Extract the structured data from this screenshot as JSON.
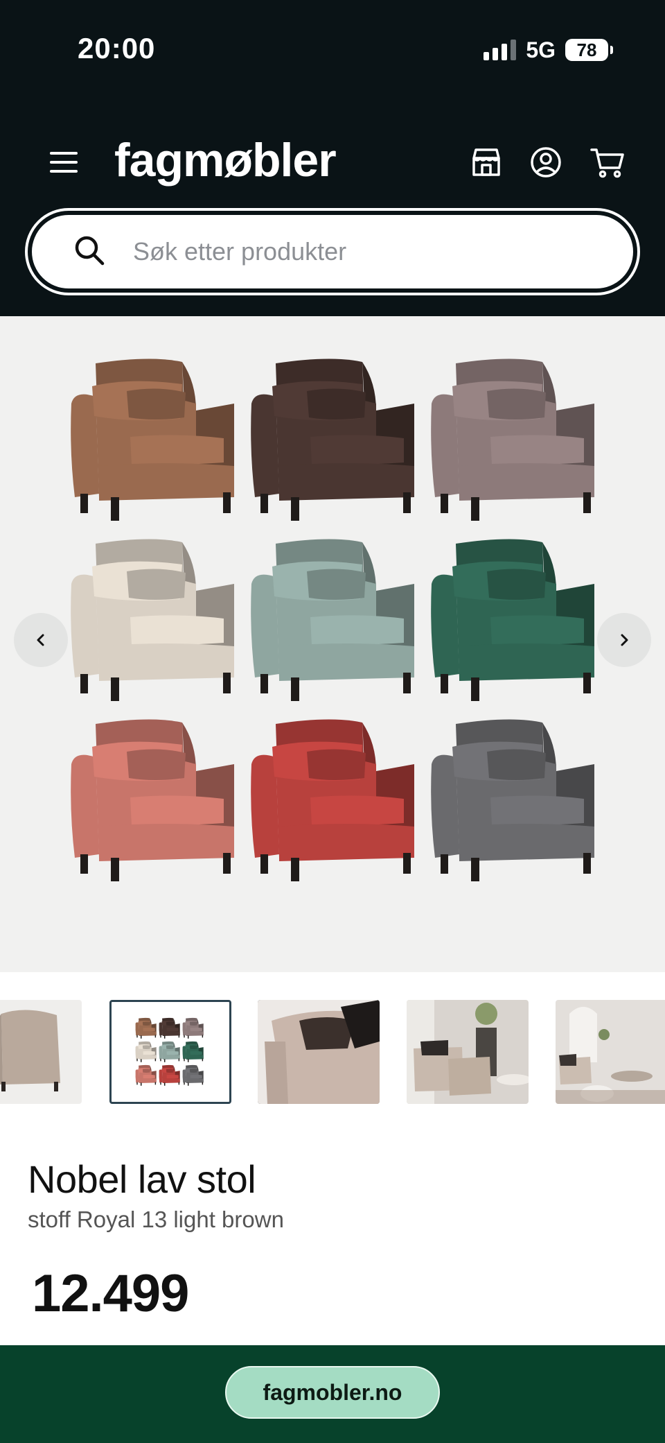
{
  "status_bar": {
    "time": "20:00",
    "network": "5G",
    "battery": "78"
  },
  "header": {
    "logo": "fagmøbler",
    "icons": [
      "menu-icon",
      "store-icon",
      "account-icon",
      "cart-icon"
    ]
  },
  "search": {
    "placeholder": "Søk etter produkter",
    "value": ""
  },
  "gallery": {
    "image_alt": "Nobel lav stol color variants",
    "chair_colors": [
      "#9a6a4f",
      "#4a3631",
      "#8d7a7a",
      "#d9d0c4",
      "#8fa6a0",
      "#2f6553",
      "#c8756a",
      "#b8413d",
      "#6a6a6d"
    ]
  },
  "product": {
    "title": "Nobel lav stol",
    "subtitle": "stoff Royal 13 light brown",
    "price": "12.499"
  },
  "footer": {
    "site": "fagmobler.no"
  },
  "colors": {
    "header_bg": "#0a1316",
    "footer_bg": "#07422b",
    "pill_bg": "#a4dcc3"
  }
}
